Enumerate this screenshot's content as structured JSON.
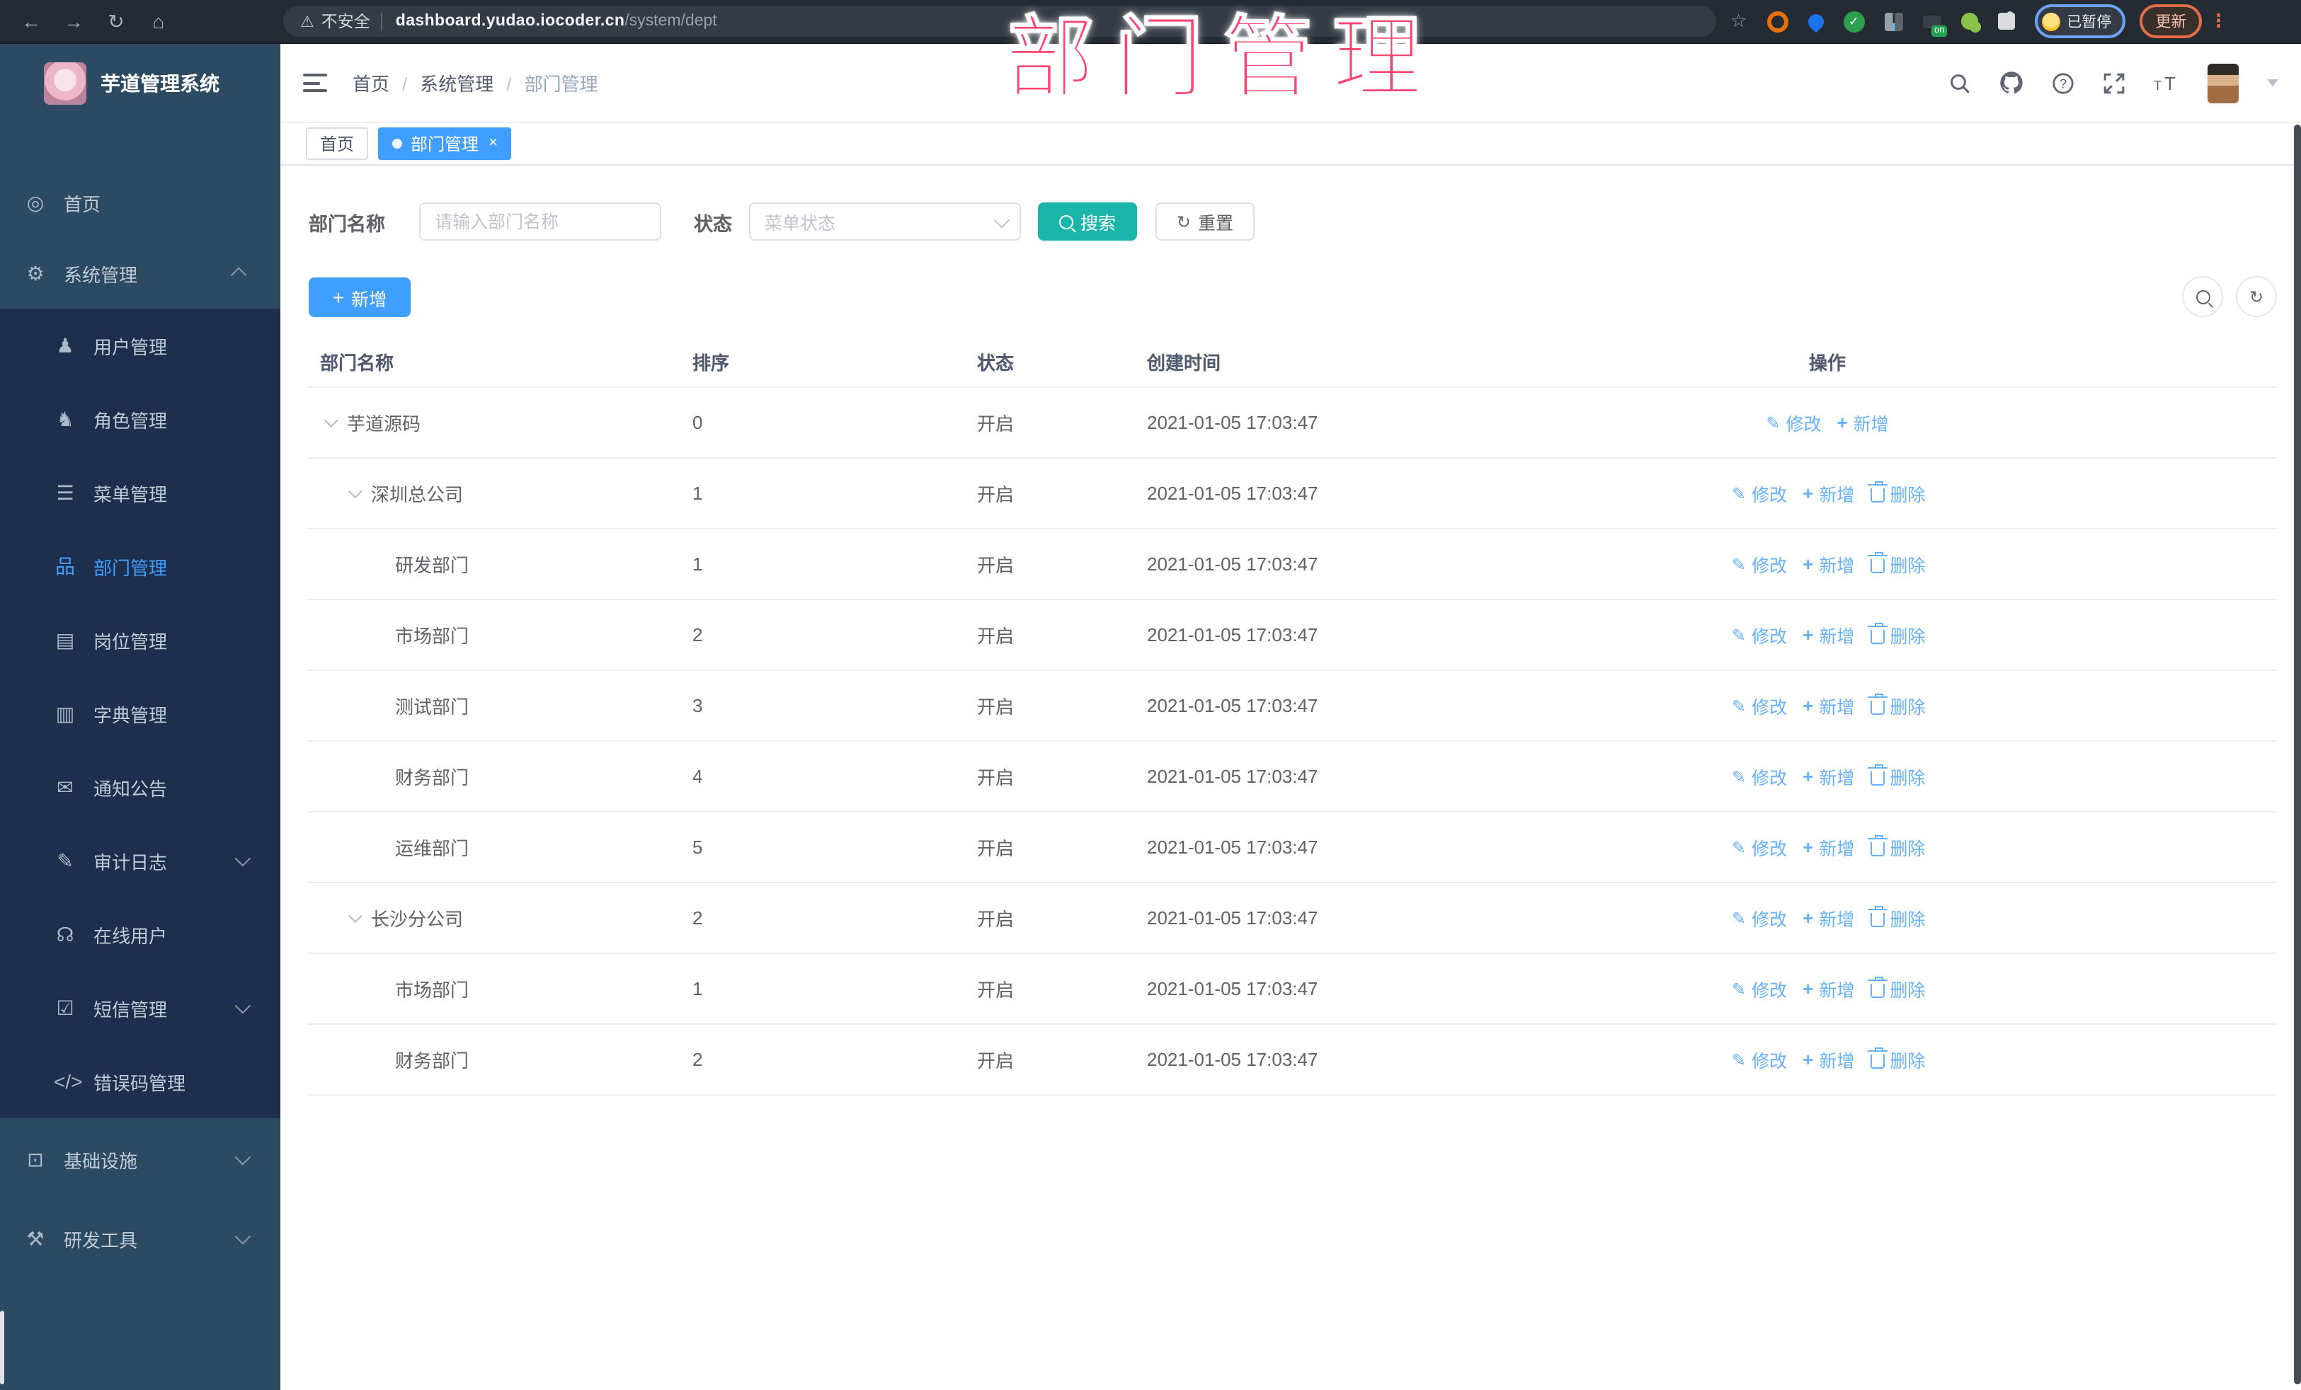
{
  "annotation": {
    "text": "部门管理",
    "color": "#fa4570"
  },
  "browser": {
    "nav": [
      {
        "name": "back-icon",
        "glyph": "←"
      },
      {
        "name": "forward-icon",
        "glyph": "→"
      },
      {
        "name": "reload-icon",
        "glyph": "↻"
      },
      {
        "name": "home-icon",
        "glyph": "⌂"
      }
    ],
    "security_icon": "warning-icon",
    "security_text": "不安全",
    "url_host": "dashboard.yudao.iocoder.cn",
    "url_path": "/system/dept",
    "bookmark_icon": "star-icon",
    "extensions": [
      {
        "name": "extension-orange-ring-icon",
        "kind": "ring",
        "glyph": "",
        "badge": ""
      },
      {
        "name": "extension-blue-drop-icon",
        "kind": "drop",
        "glyph": "",
        "badge": ""
      },
      {
        "name": "extension-green-check-icon",
        "kind": "check",
        "glyph": "✓",
        "badge": ""
      },
      {
        "name": "extension-grid-icon",
        "kind": "grid",
        "glyph": "",
        "badge": ""
      },
      {
        "name": "extension-switch-icon",
        "kind": "onbadge",
        "glyph": "",
        "badge": "on"
      },
      {
        "name": "extension-green-key-icon",
        "kind": "key",
        "glyph": "",
        "badge": ""
      },
      {
        "name": "extensions-puzzle-icon",
        "kind": "puzzle",
        "glyph": "",
        "badge": ""
      }
    ],
    "profile_chip_label": "已暂停",
    "update_button_label": "更新",
    "menu_icon": "kebab-menu-icon"
  },
  "sidebar": {
    "app_title": "芋道管理系统",
    "items": [
      {
        "label": "首页",
        "icon": "dashboard-icon",
        "glyph": "◎",
        "level": 0,
        "active": false,
        "arrow": ""
      },
      {
        "label": "系统管理",
        "icon": "gear-icon",
        "glyph": "⚙",
        "level": 0,
        "active": false,
        "arrow": "up"
      },
      {
        "label": "用户管理",
        "icon": "user-icon",
        "glyph": "♟",
        "level": 1,
        "active": false,
        "arrow": ""
      },
      {
        "label": "角色管理",
        "icon": "users-icon",
        "glyph": "♞",
        "level": 1,
        "active": false,
        "arrow": ""
      },
      {
        "label": "菜单管理",
        "icon": "menu-list-icon",
        "glyph": "☰",
        "level": 1,
        "active": false,
        "arrow": ""
      },
      {
        "label": "部门管理",
        "icon": "org-tree-icon",
        "glyph": "品",
        "level": 1,
        "active": true,
        "arrow": ""
      },
      {
        "label": "岗位管理",
        "icon": "id-badge-icon",
        "glyph": "▤",
        "level": 1,
        "active": false,
        "arrow": ""
      },
      {
        "label": "字典管理",
        "icon": "dictionary-icon",
        "glyph": "▥",
        "level": 1,
        "active": false,
        "arrow": ""
      },
      {
        "label": "通知公告",
        "icon": "announcement-icon",
        "glyph": "✉",
        "level": 1,
        "active": false,
        "arrow": ""
      },
      {
        "label": "审计日志",
        "icon": "audit-log-icon",
        "glyph": "✎",
        "level": 1,
        "active": false,
        "arrow": "down"
      },
      {
        "label": "在线用户",
        "icon": "online-users-icon",
        "glyph": "☊",
        "level": 1,
        "active": false,
        "arrow": ""
      },
      {
        "label": "短信管理",
        "icon": "sms-shield-icon",
        "glyph": "☑",
        "level": 1,
        "active": false,
        "arrow": "down"
      },
      {
        "label": "错误码管理",
        "icon": "error-code-icon",
        "glyph": "</>",
        "level": 1,
        "active": false,
        "arrow": ""
      },
      {
        "label": "基础设施",
        "icon": "infrastructure-icon",
        "glyph": "⊡",
        "level": 0,
        "active": false,
        "arrow": "down"
      },
      {
        "label": "研发工具",
        "icon": "dev-tools-icon",
        "glyph": "⚒",
        "level": 0,
        "active": false,
        "arrow": "down"
      }
    ]
  },
  "header": {
    "breadcrumb": [
      {
        "label": "首页"
      },
      {
        "label": "系统管理"
      },
      {
        "label": "部门管理"
      }
    ],
    "icons": [
      "search-icon",
      "github-icon",
      "help-icon",
      "fullscreen-icon",
      "font-size-icon",
      "user-avatar",
      "chevron-down-icon"
    ]
  },
  "tabs": [
    {
      "label": "首页",
      "active": false,
      "close": ""
    },
    {
      "label": "部门管理",
      "active": true,
      "close": "×"
    }
  ],
  "filters": {
    "name_label": "部门名称",
    "name_placeholder": "请输入部门名称",
    "name_value": "",
    "status_label": "状态",
    "status_placeholder": "菜单状态",
    "search_label": "搜索",
    "reset_label": "重置"
  },
  "toolbar": {
    "add_label": "新增"
  },
  "table": {
    "columns": [
      "部门名称",
      "排序",
      "状态",
      "创建时间",
      "操作"
    ],
    "rows": [
      {
        "name": "芋道源码",
        "level": 0,
        "expandable": true,
        "sort": "0",
        "status": "开启",
        "created": "2021-01-05 17:03:47",
        "actions": {
          "edit": "修改",
          "add": "新增",
          "del": ""
        }
      },
      {
        "name": "深圳总公司",
        "level": 1,
        "expandable": true,
        "sort": "1",
        "status": "开启",
        "created": "2021-01-05 17:03:47",
        "actions": {
          "edit": "修改",
          "add": "新增",
          "del": "删除"
        }
      },
      {
        "name": "研发部门",
        "level": 2,
        "expandable": false,
        "sort": "1",
        "status": "开启",
        "created": "2021-01-05 17:03:47",
        "actions": {
          "edit": "修改",
          "add": "新增",
          "del": "删除"
        }
      },
      {
        "name": "市场部门",
        "level": 2,
        "expandable": false,
        "sort": "2",
        "status": "开启",
        "created": "2021-01-05 17:03:47",
        "actions": {
          "edit": "修改",
          "add": "新增",
          "del": "删除"
        }
      },
      {
        "name": "测试部门",
        "level": 2,
        "expandable": false,
        "sort": "3",
        "status": "开启",
        "created": "2021-01-05 17:03:47",
        "actions": {
          "edit": "修改",
          "add": "新增",
          "del": "删除"
        }
      },
      {
        "name": "财务部门",
        "level": 2,
        "expandable": false,
        "sort": "4",
        "status": "开启",
        "created": "2021-01-05 17:03:47",
        "actions": {
          "edit": "修改",
          "add": "新增",
          "del": "删除"
        }
      },
      {
        "name": "运维部门",
        "level": 2,
        "expandable": false,
        "sort": "5",
        "status": "开启",
        "created": "2021-01-05 17:03:47",
        "actions": {
          "edit": "修改",
          "add": "新增",
          "del": "删除"
        }
      },
      {
        "name": "长沙分公司",
        "level": 1,
        "expandable": true,
        "sort": "2",
        "status": "开启",
        "created": "2021-01-05 17:03:47",
        "actions": {
          "edit": "修改",
          "add": "新增",
          "del": "删除"
        }
      },
      {
        "name": "市场部门",
        "level": 2,
        "expandable": false,
        "sort": "1",
        "status": "开启",
        "created": "2021-01-05 17:03:47",
        "actions": {
          "edit": "修改",
          "add": "新增",
          "del": "删除"
        }
      },
      {
        "name": "财务部门",
        "level": 2,
        "expandable": false,
        "sort": "2",
        "status": "开启",
        "created": "2021-01-05 17:03:47",
        "actions": {
          "edit": "修改",
          "add": "新增",
          "del": "删除"
        }
      }
    ]
  },
  "colors": {
    "accent_blue": "#409eff",
    "search_teal": "#1cb5ab",
    "annotation_pink": "#fa4570",
    "sidebar_bg": "#2d4a63",
    "submenu_bg": "#1e2f4d",
    "action_link": "#66b1ff"
  }
}
